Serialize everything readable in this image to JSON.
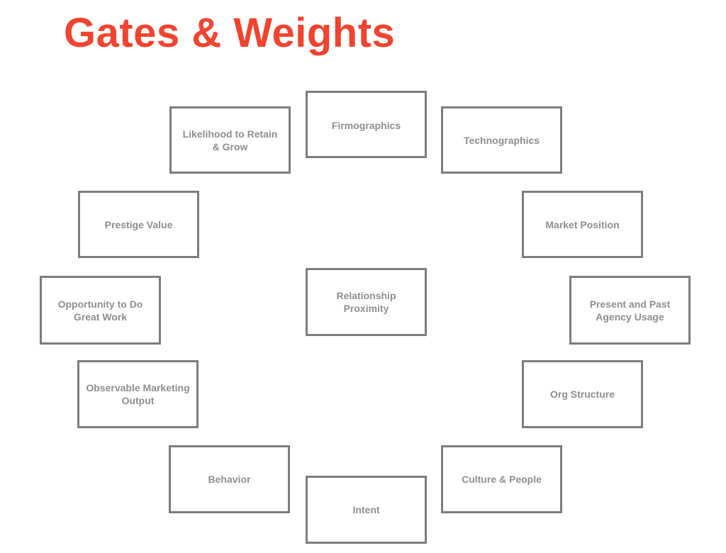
{
  "title": "Gates & Weights",
  "colors": {
    "title": "#f1432f",
    "box_border": "#7d7d7d",
    "box_text": "#8e8e8e"
  },
  "diagram": {
    "center": {
      "label": "Relationship\nProximity"
    },
    "ring": [
      {
        "label": "Firmographics"
      },
      {
        "label": "Technographics"
      },
      {
        "label": "Market Position"
      },
      {
        "label": "Present and Past\nAgency Usage"
      },
      {
        "label": "Org Structure"
      },
      {
        "label": "Culture & People"
      },
      {
        "label": "Intent"
      },
      {
        "label": "Behavior"
      },
      {
        "label": "Observable Marketing\nOutput"
      },
      {
        "label": "Opportunity to Do\nGreat Work"
      },
      {
        "label": "Prestige Value"
      },
      {
        "label": "Likelihood to Retain\n& Grow"
      }
    ]
  }
}
